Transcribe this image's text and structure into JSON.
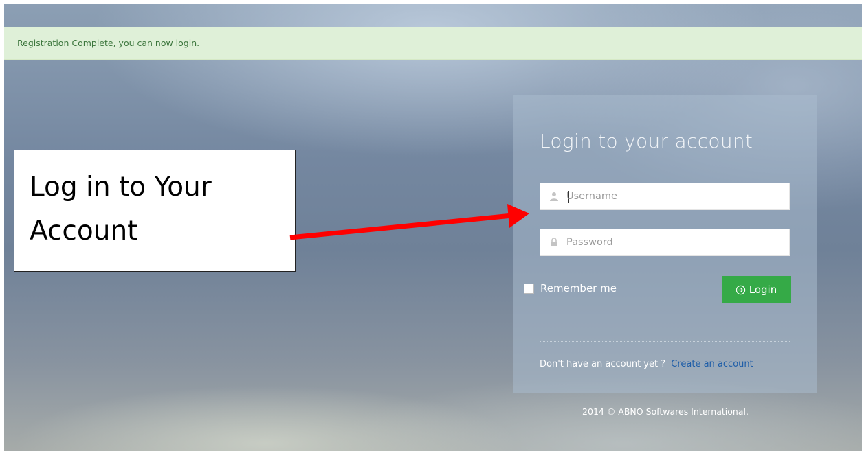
{
  "alert": {
    "message": "Registration Complete, you can now login."
  },
  "callout": {
    "line1": "Log in to Your",
    "line2": "Account"
  },
  "login": {
    "title": "Login to your account",
    "username": {
      "placeholder": "Username",
      "icon": "user-icon"
    },
    "password": {
      "placeholder": "Password",
      "icon": "lock-icon"
    },
    "remember_label": "Remember me",
    "login_button": "Login",
    "login_button_icon": "arrow-circle-right-icon",
    "signup_prompt": "Don't have an account yet ?",
    "signup_link": "Create an account"
  },
  "footer": {
    "copyright": "2014 © ABNO Softwares International."
  },
  "colors": {
    "alert_bg": "#dff0d8",
    "alert_text": "#3c763d",
    "login_button": "#35aa47",
    "link": "#1f5ea8",
    "arrow": "#ff0000"
  }
}
